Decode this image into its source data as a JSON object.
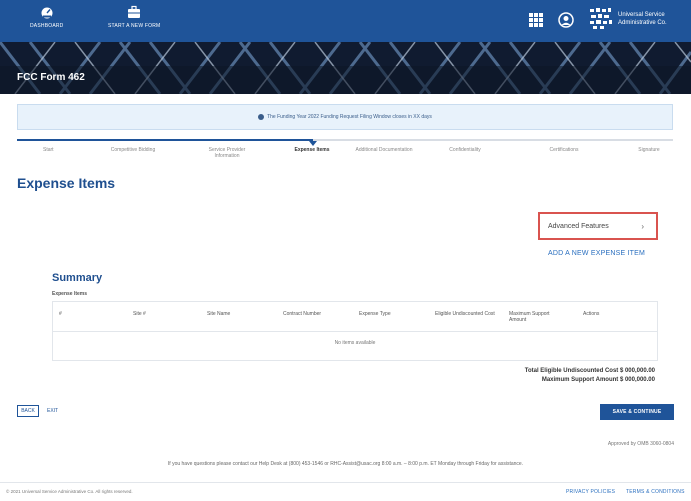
{
  "nav": {
    "dashboard": "DASHBOARD",
    "start_form": "START A NEW FORM"
  },
  "brand": {
    "line1": "Universal Service",
    "line2": "Administrative Co."
  },
  "banner": {
    "form_title": "FCC Form 462"
  },
  "alert": {
    "text": "The Funding Year 2022 Funding Request Filing Window closes in XX days"
  },
  "steps": [
    {
      "label": "Start",
      "active": false
    },
    {
      "label": "Competitive Bidding",
      "active": false
    },
    {
      "label": "Service Provider Information",
      "active": false
    },
    {
      "label": "Expense Items",
      "active": true
    },
    {
      "label": "Additional Documentation",
      "active": false
    },
    {
      "label": "Confidentiality",
      "active": false
    },
    {
      "label": "Certifications",
      "active": false
    },
    {
      "label": "Signature",
      "active": false
    }
  ],
  "page": {
    "title": "Expense Items",
    "advanced_features": "Advanced Features",
    "add_expense": "ADD A NEW EXPENSE ITEM"
  },
  "summary": {
    "title": "Summary",
    "subtitle": "Expense Items",
    "columns": [
      "#",
      "Site #",
      "Site Name",
      "Contract Number",
      "Expense Type",
      "Eligible Undiscounted Cost",
      "Maximum Support Amount",
      "Actions"
    ],
    "empty_text": "No items available",
    "total_eligible": "Total Eligible Undiscounted Cost $ 000,000.00",
    "max_support": "Maximum Support Amount $ 000,000.00"
  },
  "actions": {
    "back": "BACK",
    "exit": "EXIT",
    "save_continue": "SAVE & CONTINUE"
  },
  "footer": {
    "approved": "Approved by OMB 3060-0804",
    "help": "If you have questions please contact our Help Desk at (800) 453-1546 or RHC-Assist@usac.org 8:00 a.m. – 8:00 p.m. ET Monday through Friday for assistance.",
    "copyright": "© 2021 Universal Service Administrative Co. All rights reserved.",
    "privacy": "PRIVACY POLICIES",
    "terms": "TERMS & CONDITIONS"
  },
  "colors": {
    "primary": "#1f5499",
    "highlight": "#d9534f",
    "link": "#2a6fbf"
  }
}
